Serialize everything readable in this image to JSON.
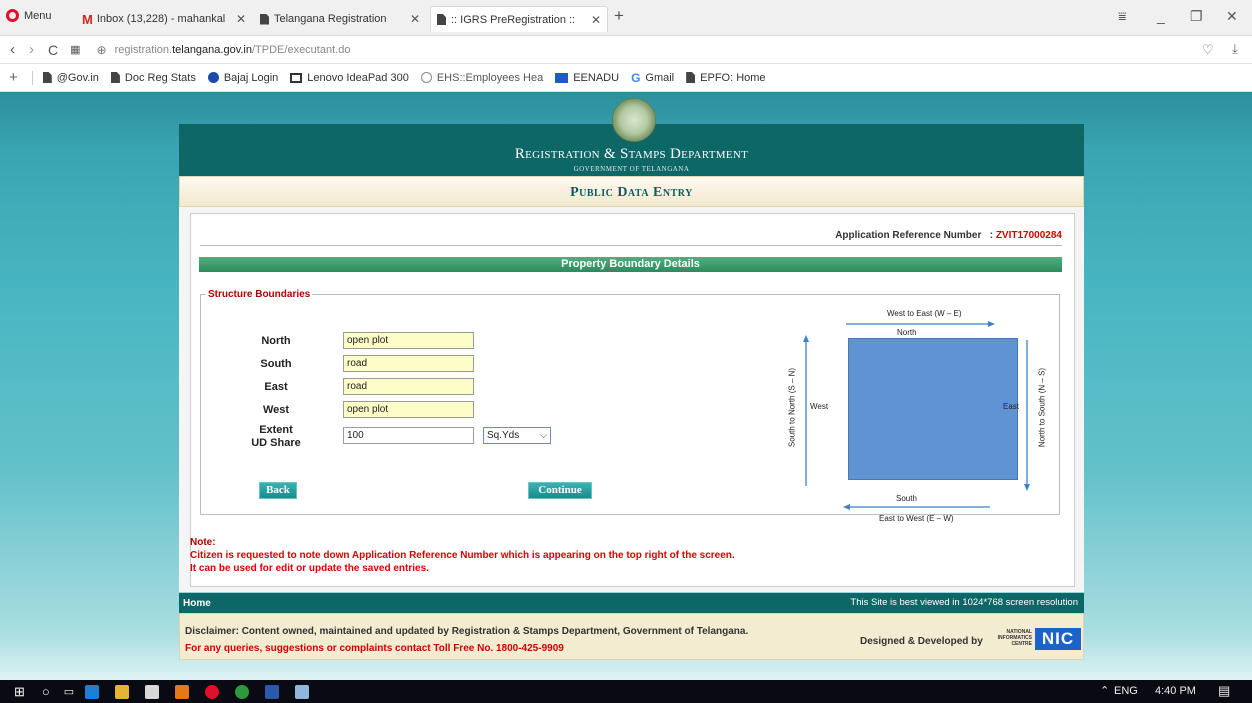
{
  "browser": {
    "menu_label": "Menu",
    "tabs": [
      {
        "title": "Inbox (13,228) - mahankal"
      },
      {
        "title": "Telangana Registration"
      },
      {
        "title": ":: IGRS PreRegistration ::"
      }
    ],
    "new_tab": "+",
    "url_domain_prefix": "registration.",
    "url_domain": "telangana.gov.in",
    "url_path": "/TPDE/executant.do",
    "bookmarks": [
      "@Gov.in",
      "Doc Reg Stats",
      "Bajaj Login",
      "Lenovo IdeaPad 300",
      "EHS::Employees Hea",
      "EENADU",
      "Gmail",
      "EPFO: Home"
    ]
  },
  "header": {
    "department": "Registration & Stamps Department",
    "government": "GOVERNMENT OF TELANGANA",
    "page_title": "Public Data Entry"
  },
  "form": {
    "ref_label": "Application Reference Number",
    "ref_sep": ":",
    "ref_value": "ZVIT17000284",
    "section_title": "Property Boundary Details",
    "fieldset_legend": "Structure Boundaries",
    "north_label": "North",
    "north_value": "open plot",
    "south_label": "South",
    "south_value": "road",
    "east_label": "East",
    "east_value": "road",
    "west_label": "West",
    "west_value": "open plot",
    "extent_label_1": "Extent",
    "extent_label_2": "UD Share",
    "extent_value": "100",
    "unit_selected": "Sq.Yds",
    "back_button": "Back",
    "continue_button": "Continue"
  },
  "diagram": {
    "top_axis": "West to East (W – E)",
    "north": "North",
    "south": "South",
    "west": "West",
    "east": "East",
    "bottom_axis": "East to West (E – W)",
    "left_axis": "South to North (S – N)",
    "right_axis": "North to South (N – S)",
    "plot_color": "#5f94d3"
  },
  "notes": {
    "title": "Note:",
    "line1": "Citizen is requested to note down Application Reference Number which is appearing on the top right of the screen.",
    "line2": "It can be used for edit or update the saved entries."
  },
  "footer": {
    "home": "Home",
    "resolution_note": "This Site is best viewed in 1024*768 screen resolution",
    "disclaimer": "Disclaimer: Content owned, maintained and updated by Registration & Stamps Department, Government of Telangana.",
    "queries": "For any queries, suggestions or complaints contact Toll Free No. 1800-425-9909",
    "designed_by": "Designed & Developed by",
    "nic_small": "NATIONAL INFORMATICS CENTRE",
    "nic": "NIC"
  },
  "taskbar": {
    "language": "ENG",
    "time": "4:40 PM"
  }
}
